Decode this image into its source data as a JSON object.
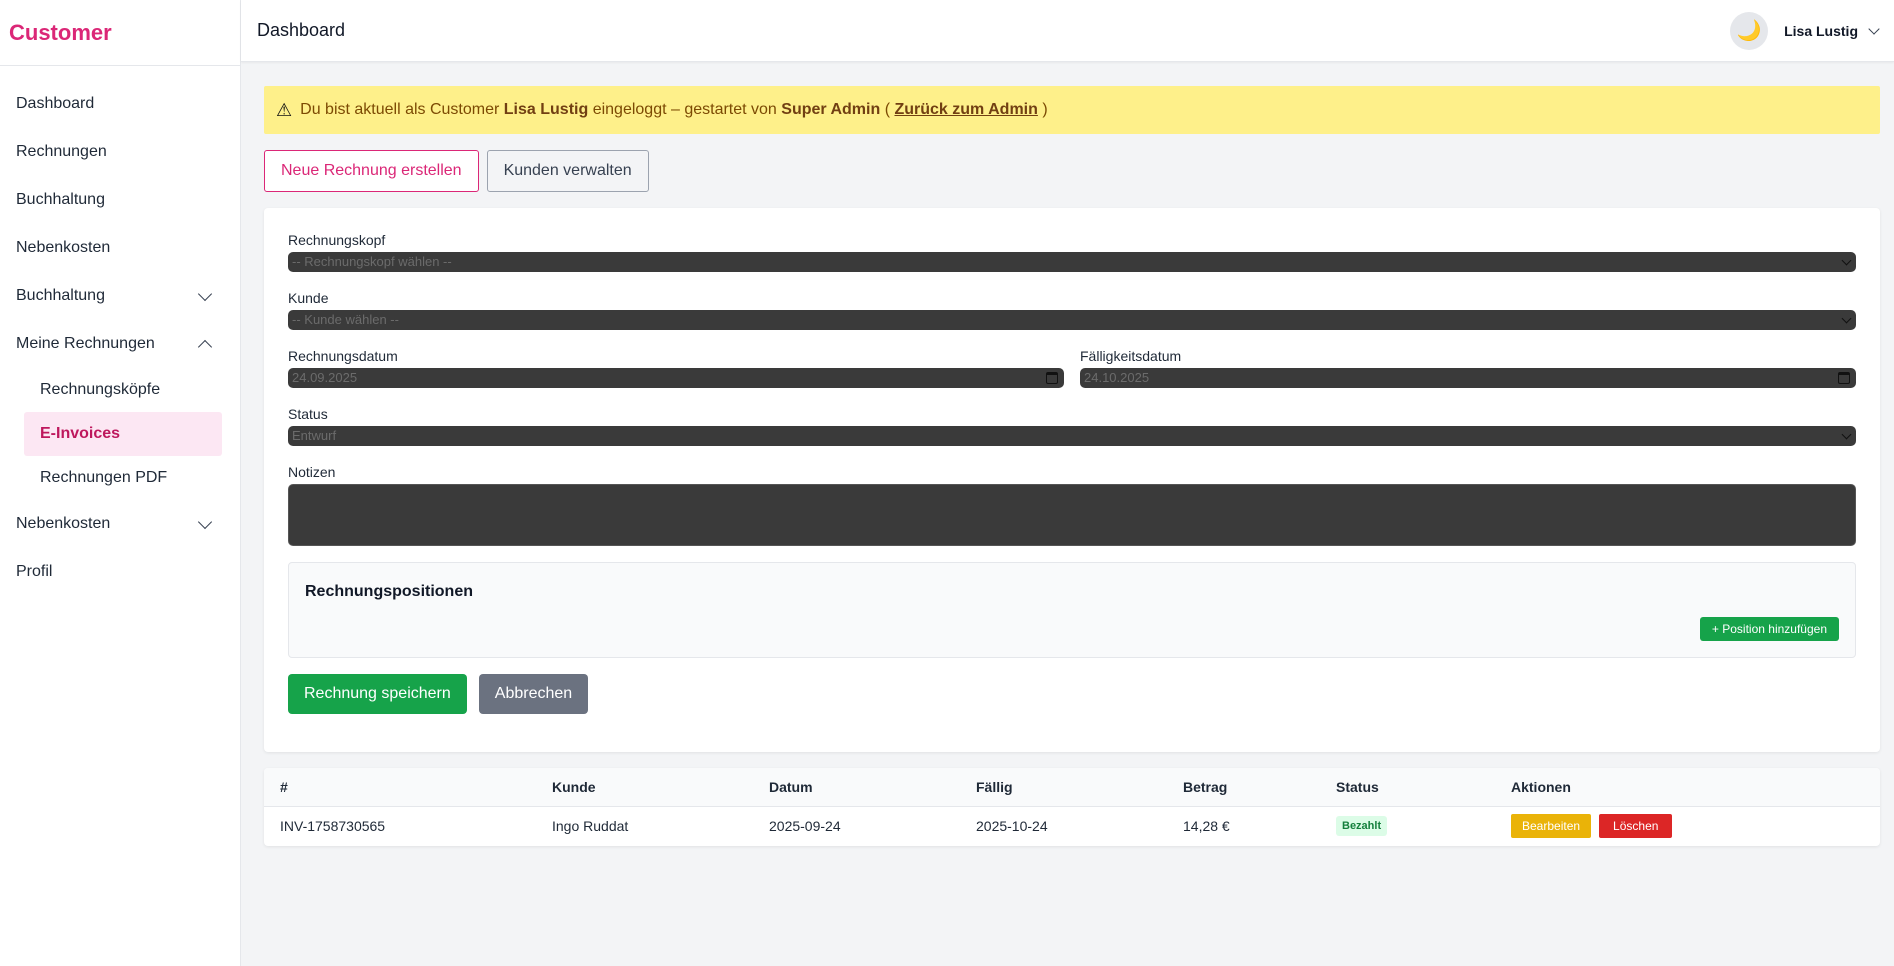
{
  "sidebar": {
    "brand": "Customer",
    "items": [
      {
        "label": "Dashboard"
      },
      {
        "label": "Rechnungen"
      },
      {
        "label": "Buchhaltung"
      },
      {
        "label": "Nebenkosten"
      },
      {
        "label": "Buchhaltung",
        "expandable": true,
        "expanded": false
      },
      {
        "label": "Meine Rechnungen",
        "expandable": true,
        "expanded": true
      },
      {
        "label": "Nebenkosten",
        "expandable": true,
        "expanded": false
      },
      {
        "label": "Profil"
      }
    ],
    "sub_items": [
      {
        "label": "Rechnungsköpfe"
      },
      {
        "label": "E-Invoices",
        "active": true
      },
      {
        "label": "Rechnungen PDF"
      }
    ]
  },
  "header": {
    "title": "Dashboard",
    "theme_icon": "moon-icon",
    "user_name": "Lisa Lustig"
  },
  "alert": {
    "icon": "warning-icon",
    "text_1": "Du bist aktuell als Customer",
    "user": "Lisa Lustig",
    "text_2": "eingeloggt – gestartet von",
    "admin": "Super Admin",
    "paren_open": "(",
    "link": "Zurück zum Admin",
    "paren_close": ")"
  },
  "actions": {
    "new_invoice": "Neue Rechnung erstellen",
    "manage_customers": "Kunden verwalten"
  },
  "form": {
    "header_label": "Rechnungskopf",
    "header_value": "-- Rechnungskopf wählen --",
    "customer_label": "Kunde",
    "customer_value": "-- Kunde wählen --",
    "invoice_date_label": "Rechnungsdatum",
    "invoice_date_value": "24.09.2025",
    "due_date_label": "Fälligkeitsdatum",
    "due_date_value": "24.10.2025",
    "status_label": "Status",
    "status_value": "Entwurf",
    "notes_label": "Notizen",
    "notes_value": "",
    "positions_title": "Rechnungspositionen",
    "add_position": "+ Position hinzufügen",
    "save": "Rechnung speichern",
    "cancel": "Abbrechen"
  },
  "table": {
    "columns": [
      "#",
      "Kunde",
      "Datum",
      "Fällig",
      "Betrag",
      "Status",
      "Aktionen"
    ],
    "rows": [
      {
        "id": "INV-1758730565",
        "customer": "Ingo Ruddat",
        "date": "2025-09-24",
        "due": "2025-10-24",
        "amount": "14,28 €",
        "status": "Bezahlt",
        "edit": "Bearbeiten",
        "delete": "Löschen"
      }
    ]
  },
  "colors": {
    "brand": "#db2777",
    "alert_bg": "#fef08a",
    "success": "#16a34a",
    "warning": "#eab308",
    "danger": "#dc2626"
  }
}
